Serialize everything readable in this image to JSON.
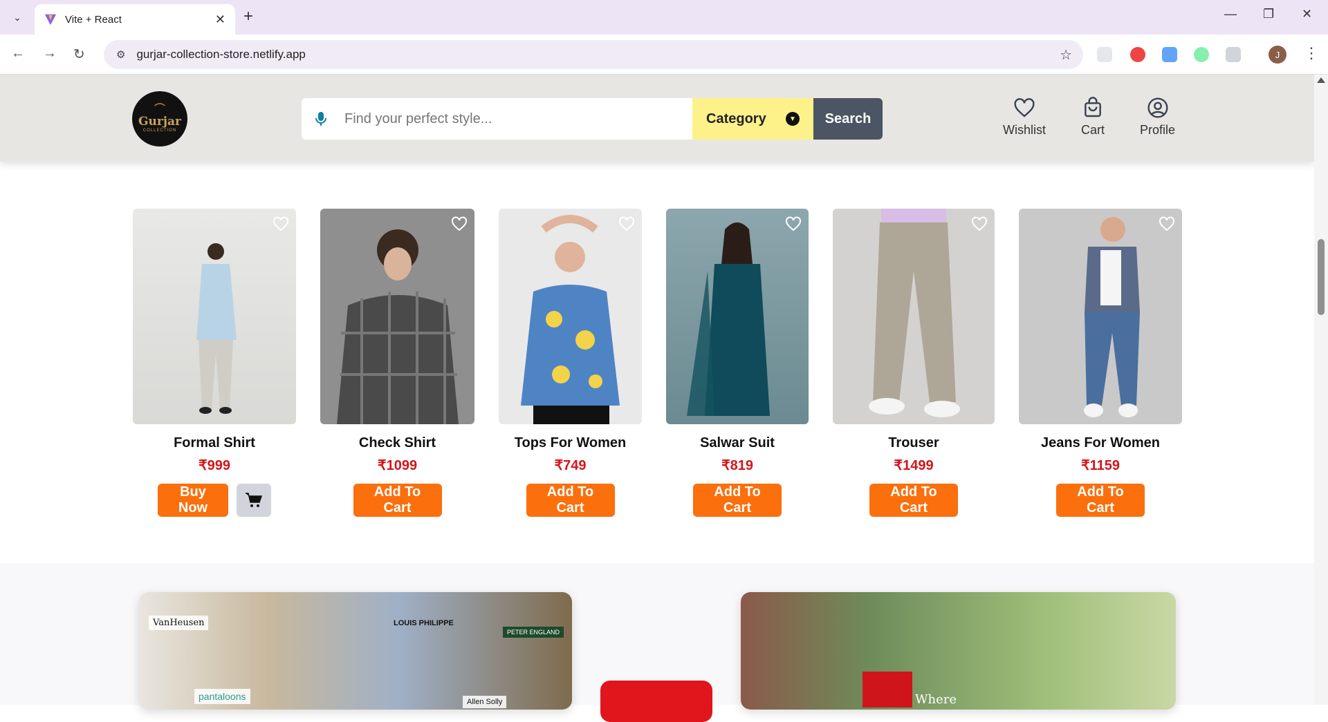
{
  "browser": {
    "tab_title": "Vite + React",
    "url": "gurjar-collection-store.netlify.app",
    "profile_initial": "J"
  },
  "site": {
    "logo_text": "Gurjar",
    "logo_sub": "COLLECTION",
    "search_placeholder": "Find your perfect style...",
    "category_label": "Category",
    "search_button": "Search",
    "nav": {
      "wishlist": "Wishlist",
      "cart": "Cart",
      "profile": "Profile"
    }
  },
  "products": [
    {
      "name": "Formal Shirt",
      "price": "₹999",
      "action": "Buy Now",
      "has_cart_icon": true
    },
    {
      "name": "Check Shirt",
      "price": "₹1099",
      "action": "Add To Cart"
    },
    {
      "name": "Tops For Women",
      "price": "₹749",
      "action": "Add To Cart"
    },
    {
      "name": "Salwar Suit",
      "price": "₹819",
      "action": "Add To Cart"
    },
    {
      "name": "Trouser",
      "price": "₹1499",
      "action": "Add To Cart"
    },
    {
      "name": "Jeans For Women",
      "price": "₹1159",
      "action": "Add To Cart"
    }
  ],
  "banners": {
    "left_brands": [
      "VanHeusen",
      "LOUIS PHILIPPE",
      "PETER ENGLAND",
      "pantaloons",
      "Allen Solly"
    ],
    "right_text": "Where"
  },
  "colors": {
    "accent_orange": "#fb6f0d",
    "price_red": "#d4151a",
    "category_yellow": "#fdf18a",
    "search_gray": "#4b5563"
  }
}
